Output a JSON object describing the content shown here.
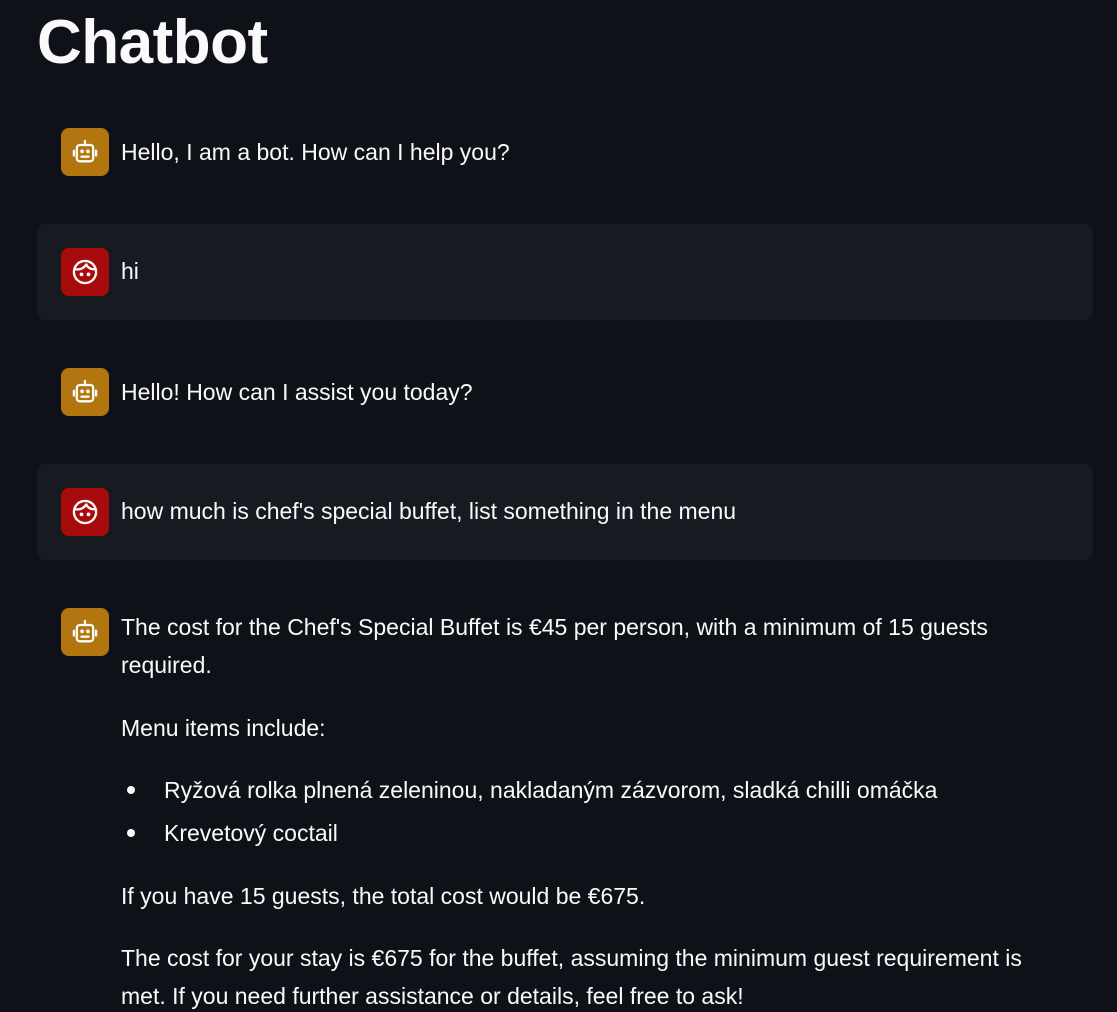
{
  "app": {
    "title": "Chatbot"
  },
  "colors": {
    "background": "#0e1117",
    "user_message_background": "#171a21",
    "bot_avatar": "#b37510",
    "user_avatar": "#a70b0b",
    "text": "#fafafa"
  },
  "messages": [
    {
      "role": "bot",
      "avatar_icon": "robot-icon",
      "text": "Hello, I am a bot. How can I help you?"
    },
    {
      "role": "user",
      "avatar_icon": "user-face-icon",
      "text": "hi"
    },
    {
      "role": "bot",
      "avatar_icon": "robot-icon",
      "text": "Hello! How can I assist you today?"
    },
    {
      "role": "user",
      "avatar_icon": "user-face-icon",
      "text": "how much is chef's special buffet, list something in the menu"
    },
    {
      "role": "bot",
      "avatar_icon": "robot-icon",
      "paragraph_1": "The cost for the Chef's Special Buffet is €45 per person, with a minimum of 15 guests required.",
      "paragraph_2": "Menu items include:",
      "menu_items": [
        "Ryžová rolka plnená zeleninou, nakladaným zázvorom, sladká chilli omáčka",
        "Krevetový coctail"
      ],
      "paragraph_3": "If you have 15 guests, the total cost would be €675.",
      "paragraph_4": "The cost for your stay is €675 for the buffet, assuming the minimum guest requirement is met. If you need further assistance or details, feel free to ask!"
    }
  ]
}
